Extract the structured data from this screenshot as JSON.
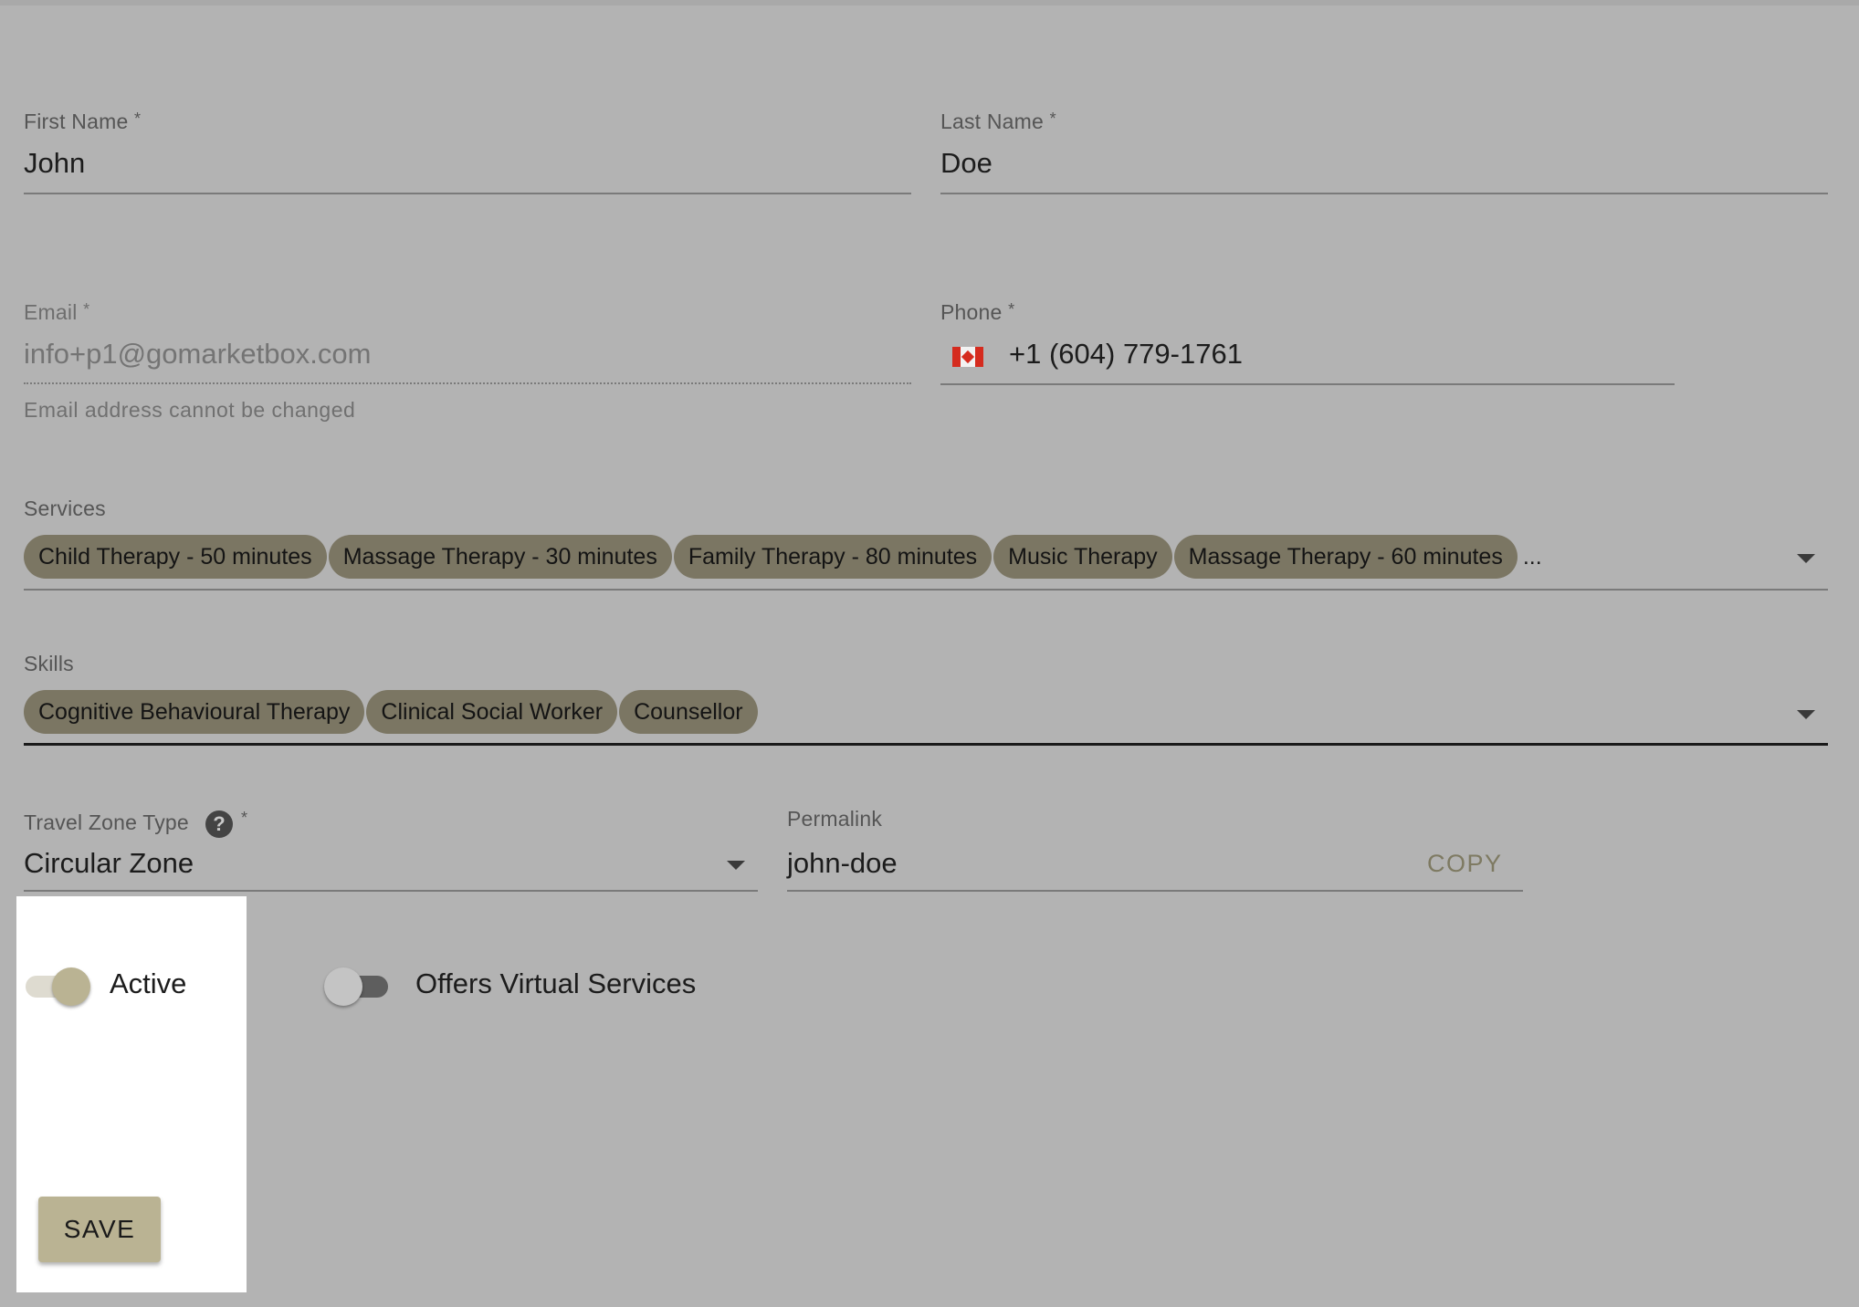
{
  "form": {
    "first_name": {
      "label": "First Name",
      "required_mark": "*",
      "value": "John"
    },
    "last_name": {
      "label": "Last Name",
      "required_mark": "*",
      "value": "Doe"
    },
    "email": {
      "label": "Email",
      "required_mark": "*",
      "value": "info+p1@gomarketbox.com",
      "helper": "Email address cannot be changed"
    },
    "phone": {
      "label": "Phone",
      "required_mark": "*",
      "value": "+1 (604) 779-1761",
      "flag_icon": "canada-flag-icon"
    },
    "services": {
      "label": "Services",
      "chips": [
        "Child Therapy - 50 minutes",
        "Massage Therapy - 30 minutes",
        "Family Therapy - 80 minutes",
        "Music Therapy",
        "Massage Therapy - 60 minutes"
      ],
      "overflow": "..."
    },
    "skills": {
      "label": "Skills",
      "chips": [
        "Cognitive Behavioural Therapy",
        "Clinical Social Worker",
        "Counsellor"
      ]
    },
    "travel_zone_type": {
      "label": "Travel Zone Type",
      "help_glyph": "?",
      "required_mark": "*",
      "value": "Circular Zone"
    },
    "permalink": {
      "label": "Permalink",
      "value": "john-doe",
      "copy_label": "COPY"
    },
    "active": {
      "label": "Active",
      "checked": true
    },
    "virtual_services": {
      "label": "Offers Virtual Services",
      "checked": false
    },
    "save_label": "SAVE"
  },
  "colors": {
    "background": "#b3b3b3",
    "chip": "#7b7663",
    "accent": "#bab393",
    "copy_text": "#7e7a62"
  }
}
